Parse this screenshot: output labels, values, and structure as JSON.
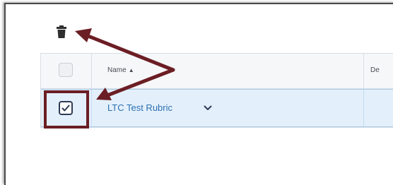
{
  "toolbar": {
    "delete_icon": "trash-icon"
  },
  "table": {
    "columns": [
      {
        "label": "Name",
        "sort_indicator": "▲"
      },
      {
        "label": "De"
      }
    ],
    "rows": [
      {
        "name": "LTC Test Rubric",
        "selected": true,
        "menu_icon": "chevron-down-icon"
      }
    ]
  },
  "annotation": {
    "arrow_color": "#6b1e24",
    "highlight_color": "#6b1e24"
  }
}
